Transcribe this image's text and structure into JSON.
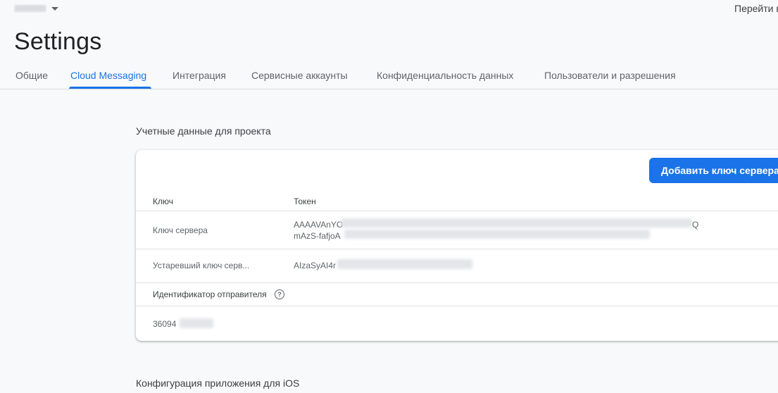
{
  "topbar": {
    "project_name": "Project",
    "goto_link": "Перейти в"
  },
  "page": {
    "title": "Settings"
  },
  "tabs": [
    {
      "label": "Общие"
    },
    {
      "label": "Cloud Messaging",
      "active": true
    },
    {
      "label": "Интеграция"
    },
    {
      "label": "Сервисные аккаунты"
    },
    {
      "label": "Конфиденциальность данных"
    },
    {
      "label": "Пользователи и разрешения"
    }
  ],
  "credentials": {
    "title": "Учетные данные для проекта",
    "add_button": "Добавить ключ сервера",
    "columns": {
      "key": "Ключ",
      "token": "Токен"
    },
    "rows": [
      {
        "key": "Ключ сервера",
        "token_line1": "AAAAVAnYO",
        "token_line1_end": "Q",
        "token_line2": "mAzS-fafjoA"
      },
      {
        "key": "Устаревший ключ серв...",
        "token_line1": "AIzaSyAI4r"
      }
    ],
    "sender_id": {
      "label": "Идентификатор отправителя",
      "value": "36094"
    }
  },
  "ios_config": {
    "title": "Конфигурация приложения для iOS"
  },
  "colors": {
    "accent": "#1a73e8",
    "background": "#f8f9fa",
    "card": "#ffffff"
  },
  "icons": {
    "help": "help-circle-icon",
    "dropdown": "caret-down-icon"
  }
}
